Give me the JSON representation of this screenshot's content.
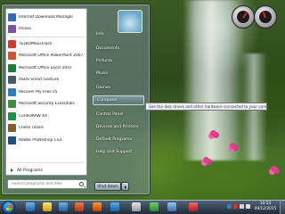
{
  "start_menu": {
    "pinned_programs": [
      {
        "label": "Internet Download Manager",
        "icon": "idm-icon",
        "color": "#2f6db5"
      },
      {
        "label": "Picasa",
        "icon": "picasa-icon",
        "color": "#7c4fb0"
      }
    ],
    "recent_programs": [
      {
        "label": "TELKOMSELFlash",
        "icon": "telkomsel-flash-icon",
        "color": "#d63a2b"
      },
      {
        "label": "Microsoft Office PowerPoint 2007",
        "icon": "powerpoint-icon",
        "color": "#d2532a"
      },
      {
        "label": "Microsoft Office Excel 2007",
        "icon": "excel-icon",
        "color": "#1e7b3a"
      },
      {
        "label": "ASUS Smart Gesture",
        "icon": "asus-gesture-icon",
        "color": "#4a5a6a"
      },
      {
        "label": "Recover My Files v5",
        "icon": "recover-files-icon",
        "color": "#2c7fc0"
      },
      {
        "label": "Microsoft Security Essentials",
        "icon": "security-essentials-icon",
        "color": "#3d8f3a"
      },
      {
        "label": "CorelDRAW X4",
        "icon": "coreldraw-icon",
        "color": "#1f8f4a"
      },
      {
        "label": "Chess Titans",
        "icon": "chess-icon",
        "color": "#8a5a2a"
      },
      {
        "label": "Adobe Photoshop CS3",
        "icon": "photoshop-icon",
        "color": "#1b4f8a"
      }
    ],
    "all_programs_label": "All Programs",
    "search_placeholder": "Search programs and files",
    "right_items": [
      "Info",
      "Documents",
      "Pictures",
      "Music",
      "Games",
      "Computer",
      "Control Panel",
      "Devices and Printers",
      "Default Programs",
      "Help and Support"
    ],
    "highlighted_item": "Computer",
    "shutdown_label": "Shut down",
    "tooltip": "See the disk drives and other hardware connected to your computer."
  },
  "taskbar": {
    "clock_time": "10:53",
    "clock_date": "09/12/2015"
  }
}
